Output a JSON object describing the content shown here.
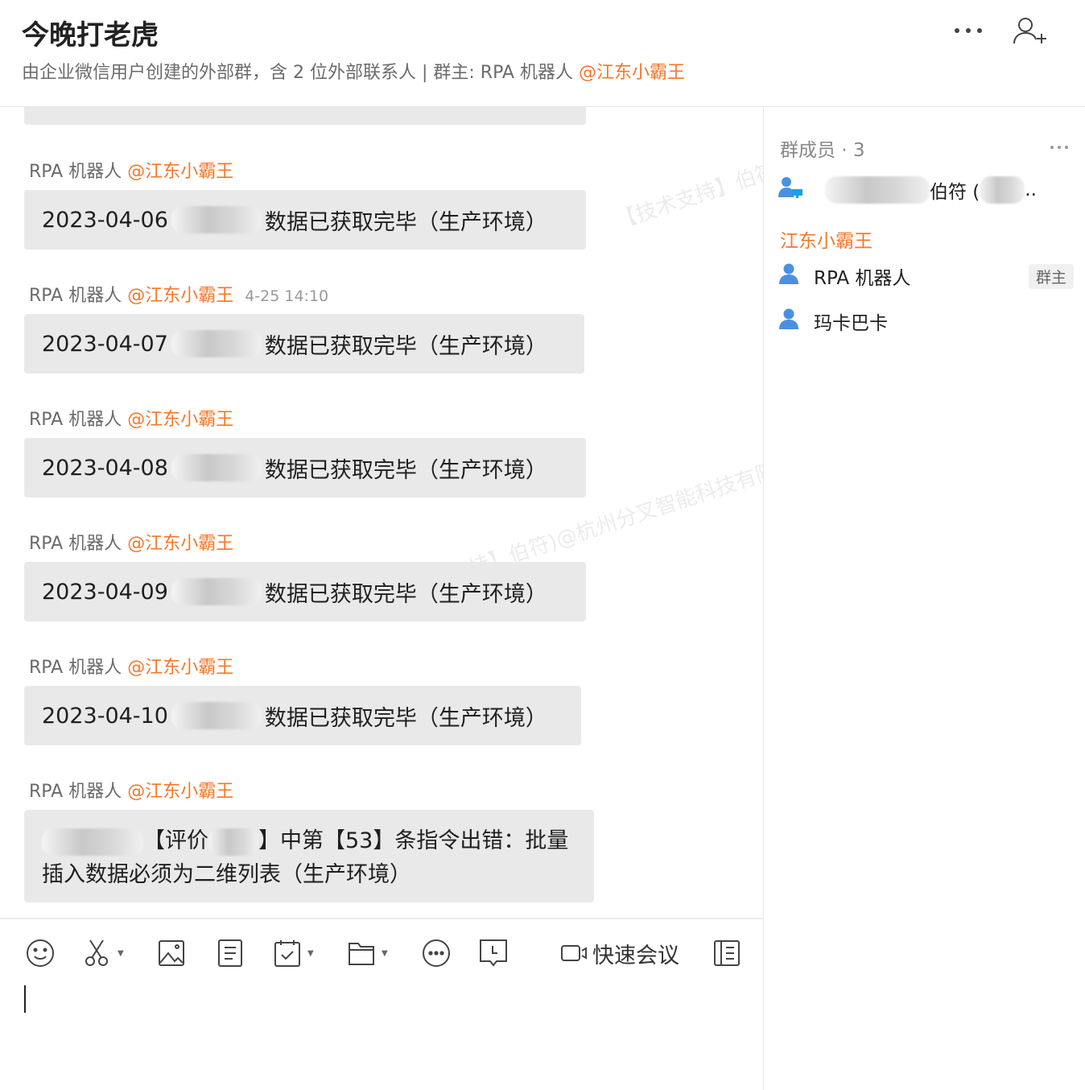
{
  "header": {
    "title": "今晚打老虎",
    "subtitle_prefix": "由企业微信用户创建的外部群，含 2 位外部联系人 | 群主: RPA 机器人 ",
    "subtitle_owner": "@江东小霸王"
  },
  "watermark": "【技术支持】伯符)@杭州分叉智能科技有限公司",
  "messages": [
    {
      "sender": "RPA 机器人 ",
      "mention": "@江东小霸王",
      "time": "",
      "date": "2023-04-06",
      "suffix": "数据已获取完毕（生产环境）"
    },
    {
      "sender": "RPA 机器人 ",
      "mention": "@江东小霸王",
      "time": "4-25 14:10",
      "date": "2023-04-07",
      "suffix": "数据已获取完毕（生产环境）"
    },
    {
      "sender": "RPA 机器人 ",
      "mention": "@江东小霸王",
      "time": "",
      "date": "2023-04-08",
      "suffix": "数据已获取完毕（生产环境）"
    },
    {
      "sender": "RPA 机器人 ",
      "mention": "@江东小霸王",
      "time": "",
      "date": "2023-04-09",
      "suffix": "数据已获取完毕（生产环境）"
    },
    {
      "sender": "RPA 机器人 ",
      "mention": "@江东小霸王",
      "time": "",
      "date": "2023-04-10",
      "suffix": "数据已获取完毕（生产环境）"
    },
    {
      "sender": "RPA 机器人 ",
      "mention": "@江东小霸王",
      "time": "",
      "line1_a": "【评价",
      "line1_b": "】中第【53】条指令出错：批量",
      "line2": "插入数据必须为二维列表（生产环境）"
    }
  ],
  "composer": {
    "meeting_label": "快速会议"
  },
  "members": {
    "header": "群成员 · 3",
    "first_name_visible": "伯符 (",
    "first_ellipsis": "..",
    "group_label": "江东小霸王",
    "items": [
      {
        "name": "RPA 机器人",
        "badge": "群主"
      },
      {
        "name": "玛卡巴卡"
      }
    ]
  },
  "colors": {
    "accent": "#f5772a",
    "icon_blue": "#4a90e2"
  }
}
